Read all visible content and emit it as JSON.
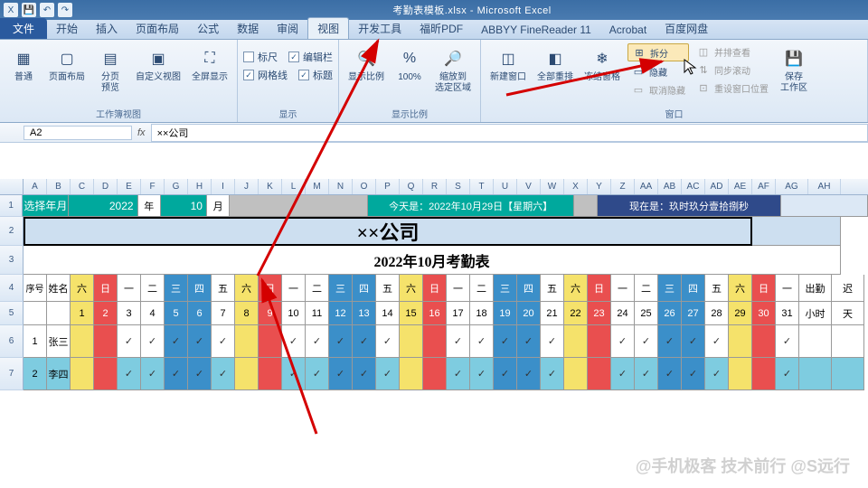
{
  "titlebar": {
    "filename": "考勤表模板.xlsx",
    "app": "Microsoft Excel"
  },
  "tabs": {
    "file": "文件",
    "home": "开始",
    "insert": "插入",
    "layout": "页面布局",
    "formulas": "公式",
    "data": "数据",
    "review": "审阅",
    "view": "视图",
    "dev": "开发工具",
    "foxit": "福昕PDF",
    "abbyy": "ABBYY FineReader 11",
    "acrobat": "Acrobat",
    "baidu": "百度网盘"
  },
  "ribbon": {
    "group1": {
      "normal": "普通",
      "pagelayout": "页面布局",
      "pagebreak": "分页\n预览",
      "custom": "自定义视图",
      "fullscreen": "全屏显示",
      "label": "工作簿视图"
    },
    "group2": {
      "ruler": "标尺",
      "formula_bar": "编辑栏",
      "gridlines": "网格线",
      "headings": "标题",
      "label": "显示"
    },
    "group3": {
      "zoom": "显示比例",
      "hundred": "100%",
      "zoomsel": "缩放到\n选定区域",
      "label": "显示比例"
    },
    "group4": {
      "newwin": "新建窗口",
      "arrange": "全部重排",
      "freeze": "冻结窗格",
      "split": "拆分",
      "hide": "隐藏",
      "unhide": "取消隐藏",
      "sidebyside": "并排查看",
      "sync": "同步滚动",
      "reset": "重设窗口位置",
      "label": "窗口"
    },
    "group5": {
      "save": "保存\n工作区"
    }
  },
  "namebox": {
    "ref": "A2",
    "fx": "fx",
    "formula": "××公司"
  },
  "cols": [
    "A",
    "B",
    "C",
    "D",
    "E",
    "F",
    "G",
    "H",
    "I",
    "J",
    "K",
    "L",
    "M",
    "N",
    "O",
    "P",
    "Q",
    "R",
    "S",
    "T",
    "U",
    "V",
    "W",
    "X",
    "Y",
    "Z",
    "AA",
    "AB",
    "AC",
    "AD",
    "AE",
    "AF",
    "AG",
    "AH"
  ],
  "row1": {
    "pick": "选择年月",
    "year": "2022",
    "year_lbl": "年",
    "month": "10",
    "month_lbl": "月",
    "today": "今天是：2022年10月29日【星期六】",
    "now": "现在是：玖时玖分壹拾捌秒"
  },
  "row2": {
    "company": "××公司"
  },
  "row3": {
    "title": "2022年10月考勤表"
  },
  "row4": {
    "seq": "序号",
    "name": "姓名",
    "dow": [
      "六",
      "日",
      "一",
      "二",
      "三",
      "四",
      "五",
      "六",
      "日",
      "一",
      "二",
      "三",
      "四",
      "五",
      "六",
      "日",
      "一",
      "二",
      "三",
      "四",
      "五",
      "六",
      "日",
      "一",
      "二",
      "三",
      "四",
      "五",
      "六",
      "日",
      "一"
    ],
    "chuqin": "出勤",
    "chidao": "迟"
  },
  "row5": {
    "days": [
      "1",
      "2",
      "3",
      "4",
      "5",
      "6",
      "7",
      "8",
      "9",
      "10",
      "11",
      "12",
      "13",
      "14",
      "15",
      "16",
      "17",
      "18",
      "19",
      "20",
      "21",
      "22",
      "23",
      "24",
      "25",
      "26",
      "27",
      "28",
      "29",
      "30",
      "31"
    ],
    "hours": "小时",
    "day": "天"
  },
  "row6": {
    "seq": "1",
    "name": "张三"
  },
  "row7": {
    "seq": "2",
    "name": "李四"
  },
  "tick": "✓",
  "chart_data": {
    "type": "table",
    "title": "2022年10月考勤表",
    "company": "××公司",
    "year": 2022,
    "month": 10,
    "columns_days": [
      1,
      2,
      3,
      4,
      5,
      6,
      7,
      8,
      9,
      10,
      11,
      12,
      13,
      14,
      15,
      16,
      17,
      18,
      19,
      20,
      21,
      22,
      23,
      24,
      25,
      26,
      27,
      28,
      29,
      30,
      31
    ],
    "columns_dow": [
      "六",
      "日",
      "一",
      "二",
      "三",
      "四",
      "五",
      "六",
      "日",
      "一",
      "二",
      "三",
      "四",
      "五",
      "六",
      "日",
      "一",
      "二",
      "三",
      "四",
      "五",
      "六",
      "日",
      "一",
      "二",
      "三",
      "四",
      "五",
      "六",
      "日",
      "一"
    ],
    "rows": [
      {
        "seq": 1,
        "name": "张三",
        "attendance": [
          null,
          null,
          "✓",
          "✓",
          "✓",
          "✓",
          "✓",
          null,
          null,
          "✓",
          "✓",
          "✓",
          "✓",
          "✓",
          null,
          null,
          "✓",
          "✓",
          "✓",
          "✓",
          "✓",
          null,
          null,
          "✓",
          "✓",
          "✓",
          "✓",
          "✓",
          null,
          null,
          "✓"
        ]
      },
      {
        "seq": 2,
        "name": "李四",
        "attendance": [
          null,
          null,
          "✓",
          "✓",
          "✓",
          "✓",
          "✓",
          null,
          null,
          "✓",
          "✓",
          "✓",
          "✓",
          "✓",
          null,
          null,
          "✓",
          "✓",
          "✓",
          "✓",
          "✓",
          null,
          null,
          "✓",
          "✓",
          "✓",
          "✓",
          "✓",
          null,
          null,
          "✓"
        ]
      }
    ]
  },
  "watermark": "@手机极客 技术前行 @S远行"
}
